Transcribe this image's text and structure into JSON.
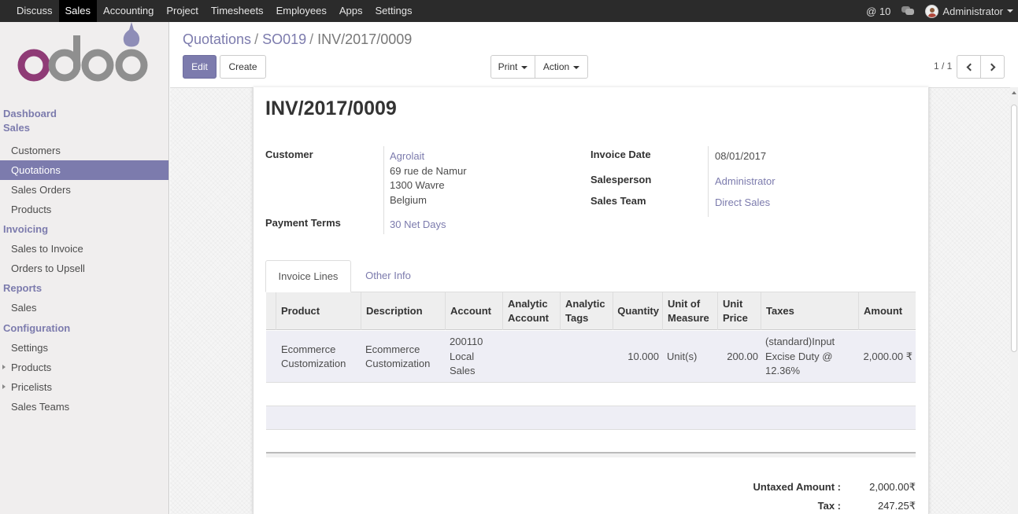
{
  "topbar": {
    "menu": [
      "Discuss",
      "Sales",
      "Accounting",
      "Project",
      "Timesheets",
      "Employees",
      "Apps",
      "Settings"
    ],
    "active": "Sales",
    "mentions": "@ 10",
    "user": "Administrator"
  },
  "brand": {
    "logo_text": "odoo",
    "primary_color": "#7c7bad",
    "logo_o_color": "#8f3b76",
    "logo_gray": "#8f8f8f"
  },
  "sidebar": {
    "dashboard": "Dashboard",
    "sales": "Sales",
    "sales_items": [
      "Customers",
      "Quotations",
      "Sales Orders",
      "Products"
    ],
    "invoicing": "Invoicing",
    "invoicing_items": [
      "Sales to Invoice",
      "Orders to Upsell"
    ],
    "reports": "Reports",
    "reports_items": [
      "Sales"
    ],
    "configuration": "Configuration",
    "configuration_items": [
      "Settings",
      "Products",
      "Pricelists",
      "Sales Teams"
    ],
    "active_item": "Quotations"
  },
  "breadcrumb": [
    "Quotations",
    "SO019",
    "INV/2017/0009"
  ],
  "buttons": {
    "edit": "Edit",
    "create": "Create",
    "print": "Print",
    "action": "Action"
  },
  "pager": "1 / 1",
  "invoice": {
    "number": "INV/2017/0009",
    "customer_label": "Customer",
    "customer_name": "Agrolait",
    "address": [
      "69 rue de Namur",
      "1300 Wavre",
      "Belgium"
    ],
    "payment_terms_label": "Payment Terms",
    "payment_terms": "30 Net Days",
    "invoice_date_label": "Invoice Date",
    "invoice_date": "08/01/2017",
    "salesperson_label": "Salesperson",
    "salesperson": "Administrator",
    "sales_team_label": "Sales Team",
    "sales_team": "Direct Sales"
  },
  "tabs": [
    "Invoice Lines",
    "Other Info"
  ],
  "table": {
    "headers": {
      "product": "Product",
      "description": "Description",
      "account": "Account",
      "analytic_account": "Analytic Account",
      "analytic_tags": "Analytic Tags",
      "quantity": "Quantity",
      "uom": "Unit of Measure",
      "unit_price": "Unit Price",
      "taxes": "Taxes",
      "amount": "Amount"
    },
    "rows": [
      {
        "product": "Ecommerce Customization",
        "description": "Ecommerce Customization",
        "account": "200110 Local Sales",
        "analytic_account": "",
        "analytic_tags": "",
        "quantity": "10.000",
        "uom": "Unit(s)",
        "unit_price": "200.00",
        "taxes": "(standard)Input Excise Duty @ 12.36%",
        "amount": "2,000.00 ₹"
      }
    ]
  },
  "totals": {
    "untaxed_label": "Untaxed Amount :",
    "untaxed": "2,000.00₹",
    "tax_label": "Tax :",
    "tax": "247.25₹"
  }
}
